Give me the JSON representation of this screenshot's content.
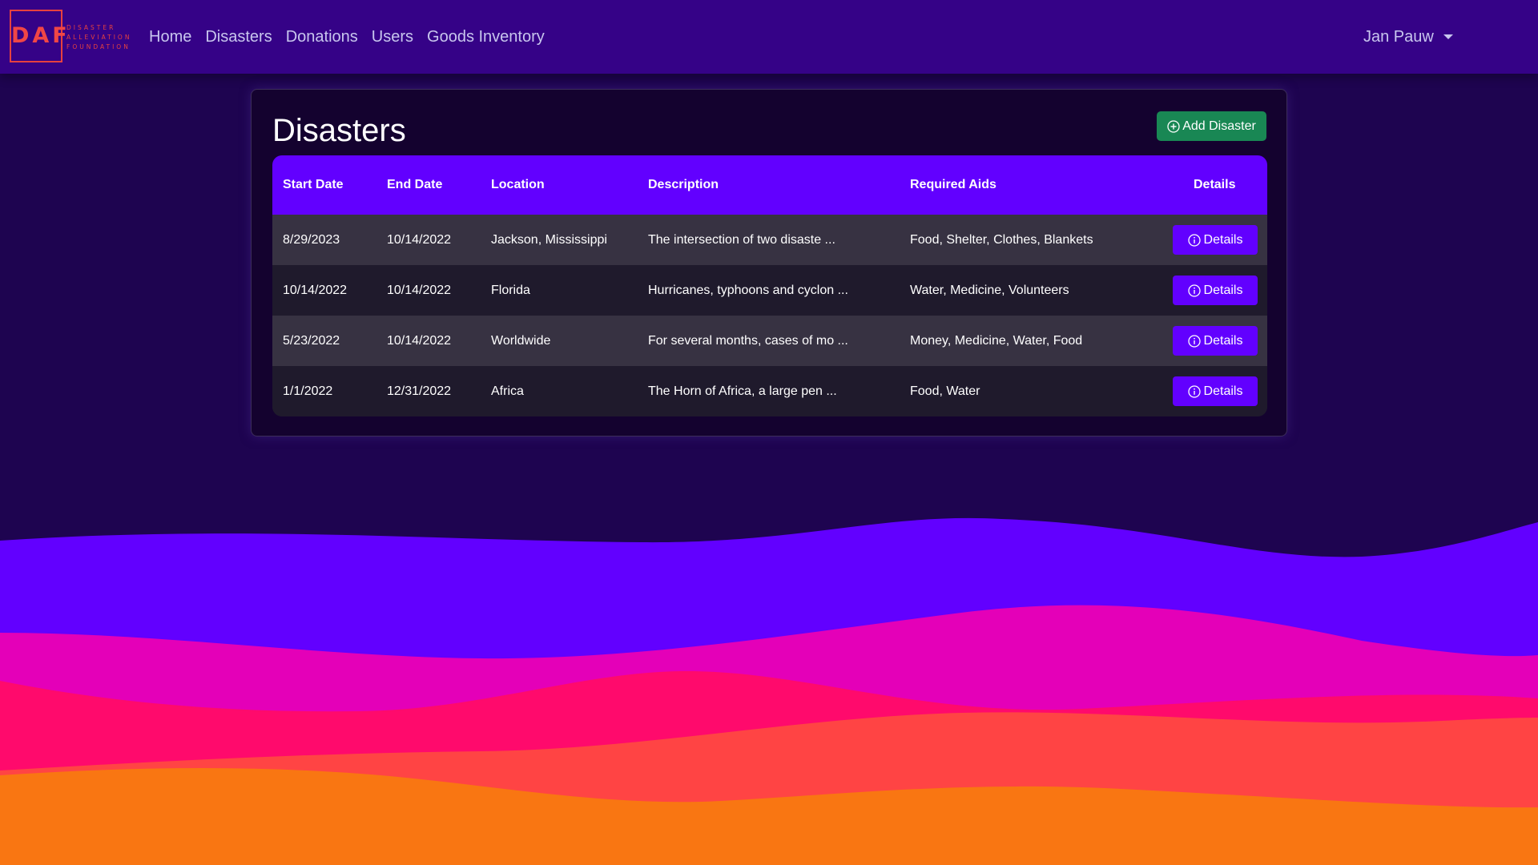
{
  "brand": {
    "logo_text": "DAF",
    "logo_subtitle": [
      "DISASTER",
      "ALLEVIATION",
      "FOUNDATION"
    ]
  },
  "nav": {
    "links": [
      "Home",
      "Disasters",
      "Donations",
      "Users",
      "Goods Inventory"
    ],
    "user_name": "Jan Pauw"
  },
  "page": {
    "title": "Disasters",
    "add_button_label": "Add Disaster"
  },
  "table": {
    "headers": [
      "Start Date",
      "End Date",
      "Location",
      "Description",
      "Required Aids",
      "Details"
    ],
    "rows": [
      {
        "start_date": "8/29/2023",
        "end_date": "10/14/2022",
        "location": "Jackson, Mississippi",
        "description": "The intersection of two disaste ...",
        "required_aids": "Food, Shelter, Clothes, Blankets",
        "details_label": "Details"
      },
      {
        "start_date": "10/14/2022",
        "end_date": "10/14/2022",
        "location": "Florida",
        "description": "Hurricanes, typhoons and cyclon ...",
        "required_aids": "Water, Medicine, Volunteers",
        "details_label": "Details"
      },
      {
        "start_date": "5/23/2022",
        "end_date": "10/14/2022",
        "location": "Worldwide",
        "description": "For several months, cases of mo ...",
        "required_aids": "Money, Medicine, Water, Food",
        "details_label": "Details"
      },
      {
        "start_date": "1/1/2022",
        "end_date": "12/31/2022",
        "location": "Africa",
        "description": "The Horn of Africa, a large pen ...",
        "required_aids": "Food, Water",
        "details_label": "Details"
      }
    ]
  },
  "colors": {
    "navbar": "#350287",
    "background": "#1e0450",
    "accent_purple": "#6200ff",
    "success_green": "#198754",
    "logo_red": "#f04646",
    "wave_magenta": "#e400b8",
    "wave_pink": "#ff0a6c",
    "wave_coral": "#ff4444",
    "wave_orange": "#f97612"
  },
  "icons": {
    "add_button": "plus-circle-icon",
    "details_button": "info-circle-icon",
    "user_menu": "caret-down-icon"
  }
}
